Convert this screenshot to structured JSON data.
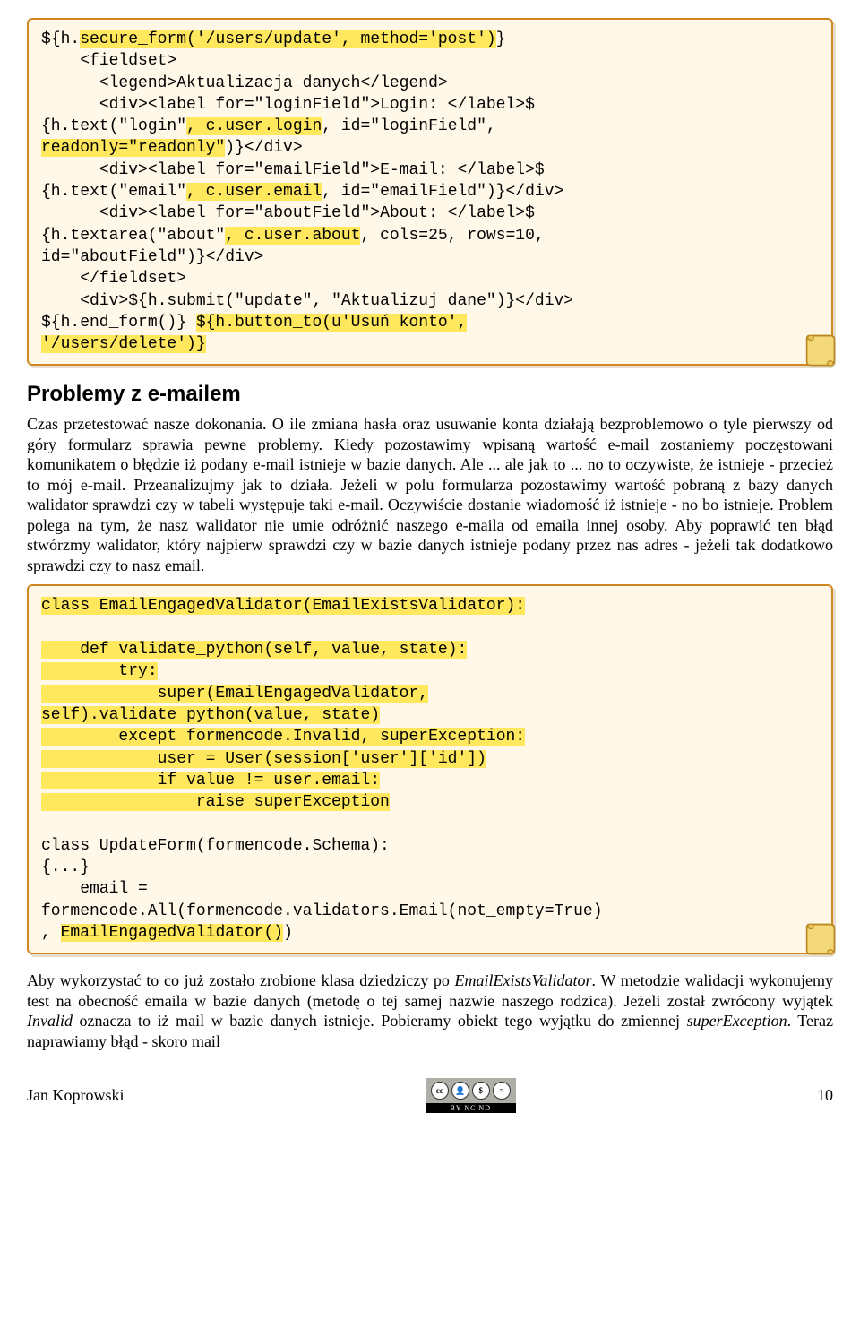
{
  "code1": {
    "l1a": "${h.",
    "l1b": "secure_form('/users/update', method='post')",
    "l1c": "}",
    "l2": "    <fieldset>",
    "l3": "      <legend>Aktualizacja danych</legend>",
    "l4": "      <div><label for=\"loginField\">Login: </label>$",
    "l5a": "{h.text(\"login\"",
    "l5b": ", c.user.login",
    "l5c": ", id=\"loginField\", ",
    "l6a": "readonly=\"readonly\"",
    "l6b": ")}</div>",
    "l7": "      <div><label for=\"emailField\">E-mail: </label>$",
    "l8a": "{h.text(\"email\"",
    "l8b": ", c.user.email",
    "l8c": ", id=\"emailField\")}</div>",
    "l9": "      <div><label for=\"aboutField\">About: </label>$",
    "l10a": "{h.textarea(\"about\"",
    "l10b": ", c.user.about",
    "l10c": ", cols=25, rows=10,",
    "l11": "id=\"aboutField\")}</div>",
    "l12": "    </fieldset>",
    "l13": "    <div>${h.submit(\"update\", \"Aktualizuj dane\")}</div>",
    "l14a": "${h.end_form()} ",
    "l14b": "${h.button_to(u'Usuń konto',",
    "l15": "'/users/delete')}"
  },
  "heading": "Problemy z e-mailem",
  "para1": "Czas przetestować nasze dokonania. O ile zmiana hasła oraz usuwanie konta działają bezproblemowo o tyle pierwszy od góry formularz sprawia pewne problemy. Kiedy pozostawimy wpisaną wartość e-mail zostaniemy poczęstowani komunikatem o błędzie iż podany e-mail istnieje w bazie danych. Ale ... ale jak to ... no to oczywiste, że istnieje - przecież to mój e-mail. Przeanalizujmy jak to działa. Jeżeli w polu formularza pozostawimy wartość pobraną z bazy danych walidator sprawdzi czy w tabeli występuje taki e-mail. Oczywiście dostanie wiadomość iż istnieje - no bo istnieje. Problem polega na tym, że nasz walidator nie umie odróżnić naszego e-maila od emaila innej osoby. Aby poprawić ten błąd stwórzmy walidator, który najpierw sprawdzi czy w bazie danych istnieje podany przez nas adres - jeżeli tak dodatkowo sprawdzi czy to nasz email.",
  "code2": {
    "l1": "class EmailEngagedValidator(EmailExistsValidator):",
    "l2": "",
    "l3": "    def validate_python(self, value, state):",
    "l4": "        try:",
    "l5": "            super(EmailEngagedValidator,",
    "l6": "self).validate_python(value, state)",
    "l7": "        except formencode.Invalid, superException:",
    "l8": "            user = User(session['user']['id'])",
    "l9": "            if value != user.email:",
    "l10": "                raise superException",
    "l11": "",
    "l12": "class UpdateForm(formencode.Schema):",
    "l13": "{...}",
    "l14": "    email =",
    "l15": "formencode.All(formencode.validators.Email(not_empty=True)",
    "l16a": ", ",
    "l16b": "EmailEngagedValidator()",
    "l16c": ")"
  },
  "para2a": "Aby wykorzystać to co już zostało zrobione klasa dziedziczy po ",
  "para2b": "EmailExistsValidator",
  "para2c": ". W metodzie walidacji wykonujemy test na obecność emaila w bazie danych (metodę o tej samej nazwie naszego rodzica). Jeżeli został zwrócony wyjątek ",
  "para2d": "Invalid",
  "para2e": " oznacza to iż mail w bazie danych istnieje. Pobieramy obiekt tego wyjątku do zmiennej ",
  "para2f": "superException",
  "para2g": ". Teraz naprawiamy błąd - skoro mail",
  "footer": {
    "author": "Jan Koprowski",
    "page": "10",
    "license": "BY NC ND"
  }
}
